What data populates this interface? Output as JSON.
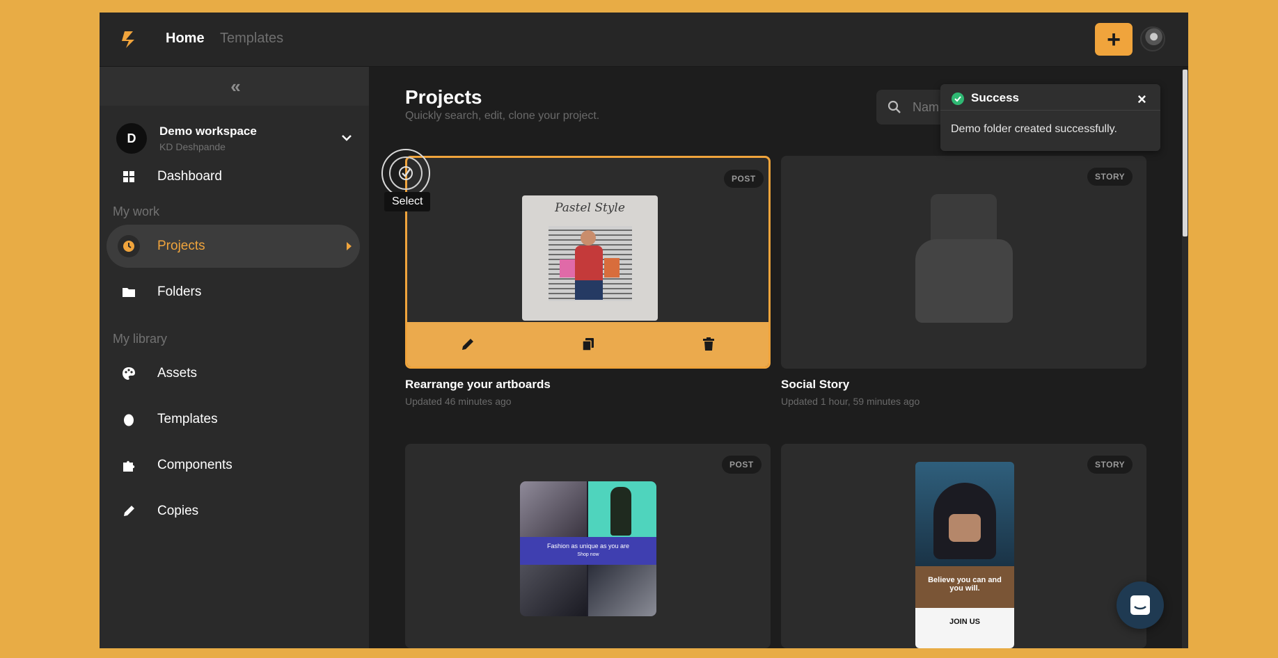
{
  "nav": {
    "home": "Home",
    "templates": "Templates",
    "add_label": "+"
  },
  "sidebar": {
    "collapse": "«",
    "workspace": {
      "initial": "D",
      "name": "Demo workspace",
      "user": "KD Deshpande"
    },
    "dashboard": "Dashboard",
    "section_work": "My work",
    "projects": "Projects",
    "folders": "Folders",
    "section_library": "My library",
    "assets": "Assets",
    "templates": "Templates",
    "components": "Components",
    "copies": "Copies"
  },
  "main": {
    "title": "Projects",
    "subtitle": "Quickly search, edit, clone your project.",
    "search_placeholder": "Nam",
    "tooltip": "Select",
    "cards": [
      {
        "badge": "POST",
        "title": "Rearrange your artboards",
        "meta": "Updated 46 minutes ago",
        "thumb_text": "Pastel Style"
      },
      {
        "badge": "STORY",
        "title": "Social Story",
        "meta": "Updated 1 hour, 59 minutes ago"
      },
      {
        "badge": "POST",
        "thumb_text": "Fashion as unique as you are",
        "thumb_sub": "Shop now"
      },
      {
        "badge": "STORY",
        "thumb_text": "Believe you can and you will.",
        "thumb_cta": "JOIN US"
      }
    ]
  },
  "toast": {
    "title": "Success",
    "close": "×",
    "message": "Demo folder created successfully."
  },
  "colors": {
    "accent": "#f0a43c",
    "background": "#e8ac45",
    "panel": "#1d1d1d",
    "success": "#2fb873"
  }
}
